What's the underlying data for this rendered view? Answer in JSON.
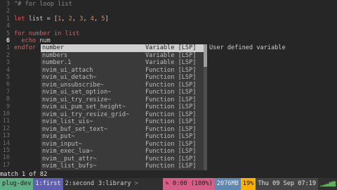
{
  "editor": {
    "lines": [
      {
        "ln": "3",
        "cls": "",
        "parts": [
          {
            "t": "\"# for loop list",
            "c": "cmt"
          }
        ]
      },
      {
        "ln": "2",
        "cls": "",
        "parts": []
      },
      {
        "ln": "1",
        "cls": "",
        "parts": [
          {
            "t": "let",
            "c": "kw"
          },
          {
            "t": " list = [",
            "c": "plain"
          },
          {
            "t": "1",
            "c": "num"
          },
          {
            "t": ", ",
            "c": "plain"
          },
          {
            "t": "2",
            "c": "num"
          },
          {
            "t": ", ",
            "c": "plain"
          },
          {
            "t": "3",
            "c": "num"
          },
          {
            "t": ", ",
            "c": "plain"
          },
          {
            "t": "4",
            "c": "num"
          },
          {
            "t": ", ",
            "c": "plain"
          },
          {
            "t": "5",
            "c": "num"
          },
          {
            "t": "]",
            "c": "plain"
          }
        ]
      },
      {
        "ln": "4",
        "cls": "",
        "parts": []
      },
      {
        "ln": "5",
        "cls": "",
        "parts": [
          {
            "t": "for",
            "c": "kw"
          },
          {
            "t": " number ",
            "c": "kw"
          },
          {
            "t": "in",
            "c": "kw"
          },
          {
            "t": " list",
            "c": "kw"
          }
        ]
      },
      {
        "ln": "6",
        "cls": "cur",
        "parts": [
          {
            "t": "  echo",
            "c": "kw"
          },
          {
            "t": " num",
            "c": "plain"
          }
        ]
      },
      {
        "ln": "1",
        "cls": "",
        "parts": [
          {
            "t": "endfor",
            "c": "kw"
          }
        ]
      },
      {
        "ln": "2",
        "cls": "",
        "parts": []
      },
      {
        "ln": "3",
        "cls": "",
        "parts": []
      },
      {
        "ln": "4",
        "cls": "",
        "parts": []
      },
      {
        "ln": "5",
        "cls": "",
        "parts": []
      },
      {
        "ln": "6",
        "cls": "",
        "parts": []
      },
      {
        "ln": "7",
        "cls": "",
        "parts": []
      },
      {
        "ln": "8",
        "cls": "",
        "parts": []
      },
      {
        "ln": "9",
        "cls": "",
        "parts": []
      },
      {
        "ln": "10",
        "cls": "",
        "parts": []
      },
      {
        "ln": "11",
        "cls": "",
        "parts": []
      },
      {
        "ln": "12",
        "cls": "",
        "parts": []
      },
      {
        "ln": "13",
        "cls": "",
        "parts": []
      },
      {
        "ln": "14",
        "cls": "",
        "parts": []
      },
      {
        "ln": "15",
        "cls": "",
        "parts": []
      },
      {
        "ln": "16",
        "cls": "",
        "parts": []
      },
      {
        "ln": "17",
        "cls": "",
        "parts": []
      }
    ]
  },
  "completion": {
    "items": [
      {
        "word": "number",
        "kind": "Variable [LSP]",
        "selected": true
      },
      {
        "word": "numbers",
        "kind": "Variable [LSP]"
      },
      {
        "word": "number.1",
        "kind": "Variable [LSP]"
      },
      {
        "word": "nvim_ui_attach",
        "kind": "Function [LSP]"
      },
      {
        "word": "nvim_ui_detach~",
        "kind": "Function [LSP]"
      },
      {
        "word": "nvim_unsubscribe~",
        "kind": "Function [LSP]"
      },
      {
        "word": "nvim_ui_set_option~",
        "kind": "Function [LSP]"
      },
      {
        "word": "nvim_ui_try_resize~",
        "kind": "Function [LSP]"
      },
      {
        "word": "nvim_ui_pum_set_height~",
        "kind": "Function [LSP]"
      },
      {
        "word": "nvim_ui_try_resize_grid~",
        "kind": "Function [LSP]"
      },
      {
        "word": "nvim_list_uis~",
        "kind": "Function [LSP]"
      },
      {
        "word": "nvim_buf_set_text~",
        "kind": "Function [LSP]"
      },
      {
        "word": "nvim_put~",
        "kind": "Function [LSP]"
      },
      {
        "word": "nvim_input~",
        "kind": "Function [LSP]"
      },
      {
        "word": "nvim_exec_lua~",
        "kind": "Function [LSP]"
      },
      {
        "word": "nvim__put_attr~",
        "kind": "Function [LSP]"
      },
      {
        "word": "nvim_list_bufs~",
        "kind": "Function [LSP]"
      }
    ],
    "doc": "User defined variable"
  },
  "message": "match 1 of 82",
  "tmux": {
    "session": "plug-dev",
    "windows": [
      {
        "label": "1:first",
        "current": true
      },
      {
        "label": "2:second",
        "current": false
      },
      {
        "label": "3:library",
        "current": false
      }
    ],
    "arrow": ">",
    "battery": "✎ 0:00 (100%)",
    "memory": "2076MB",
    "cpu": "19%",
    "clock": "Thu 09 Sep 07:19",
    "bars": "▁▂▃▅▆"
  }
}
